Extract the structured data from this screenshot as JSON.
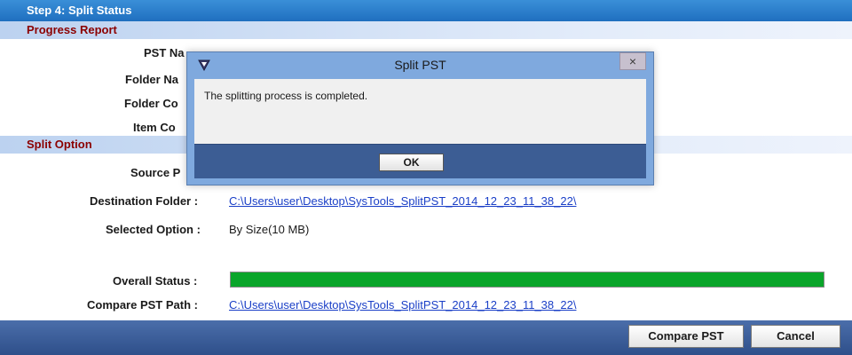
{
  "step_header": {
    "title": "Step 4:  Split Status"
  },
  "progress_report": {
    "section_title": "Progress Report",
    "pst_name_label": "PST Na",
    "folder_name_label": "Folder Na",
    "folder_count_label": "Folder Co",
    "item_count_label": "Item Co"
  },
  "split_option": {
    "section_title": "Split Option",
    "source_label": "Source P",
    "destination_label": "Destination Folder :",
    "destination_value": "C:\\Users\\user\\Desktop\\SysTools_SplitPST_2014_12_23_11_38_22\\",
    "selected_option_label": "Selected Option :",
    "selected_option_value": "By Size(10 MB)",
    "overall_status_label": "Overall Status  :",
    "overall_status_progress": 1.0,
    "compare_path_label": "Compare PST Path :",
    "compare_path_value": "C:\\Users\\user\\Desktop\\SysTools_SplitPST_2014_12_23_11_38_22\\"
  },
  "footer": {
    "compare_button": "Compare PST",
    "cancel_button": "Cancel"
  },
  "dialog": {
    "title": "Split PST",
    "close_glyph": "×",
    "message": "The splitting process is completed.",
    "ok_button": "OK"
  },
  "colors": {
    "header_blue": "#1f6fbf",
    "section_text": "#8b0000",
    "progress_green": "#0aa52a",
    "link_blue": "#1a3fc7",
    "footer_blue": "#2e4f8a"
  }
}
